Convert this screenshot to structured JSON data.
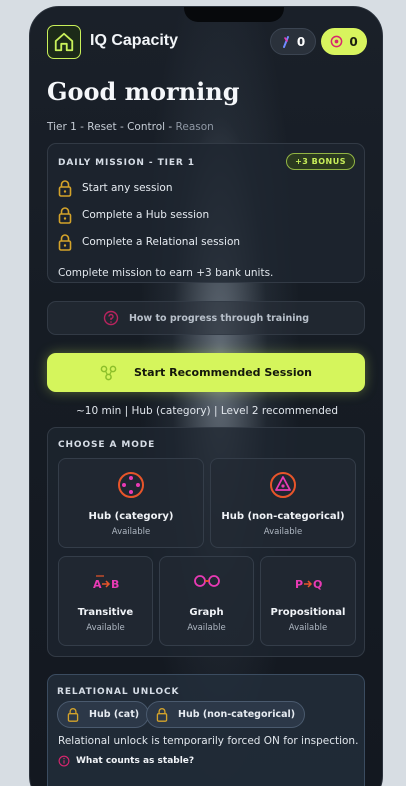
{
  "app": {
    "title": "IQ Capacity"
  },
  "header": {
    "tokens_count": "0",
    "bank_count": "0"
  },
  "greeting": "Good morning",
  "tier_path": {
    "tier": "Tier 1",
    "sep1": " - ",
    "reset": "Reset",
    "sep2": " - ",
    "control": "Control",
    "sep3": " - ",
    "reason": "Reason"
  },
  "mission": {
    "title": "DAILY MISSION - TIER 1",
    "bonus": "+3 BONUS",
    "items": [
      {
        "label": "Start any session"
      },
      {
        "label": "Complete a Hub session"
      },
      {
        "label": "Complete a Relational session"
      }
    ],
    "footer": "Complete mission to earn +3 bank units."
  },
  "howto": {
    "label": "How to progress through training"
  },
  "start": {
    "label": "Start Recommended Session"
  },
  "recommendation": "~10 min | Hub (category) | Level 2 recommended",
  "modes": {
    "title": "CHOOSE A MODE",
    "items": [
      {
        "name": "Hub (category)",
        "status": "Available"
      },
      {
        "name": "Hub (non-categorical)",
        "status": "Available"
      },
      {
        "name": "Transitive",
        "status": "Available"
      },
      {
        "name": "Graph",
        "status": "Available"
      },
      {
        "name": "Propositional",
        "status": "Available"
      }
    ]
  },
  "unlock": {
    "title": "RELATIONAL UNLOCK",
    "chips": [
      {
        "label": "Hub (cat)"
      },
      {
        "label": "Hub (non-categorical)"
      }
    ],
    "note": "Relational unlock is temporarily forced ON for inspection.",
    "stable_link": "What counts as stable?"
  },
  "colors": {
    "accent": "#d5f55c",
    "lock": "#d4a32a",
    "icon_magenta": "#e83ab4",
    "icon_orange": "#e8552a"
  },
  "icons": [
    "home-icon",
    "token-icon",
    "bank-icon",
    "lock-icon",
    "progress-icon",
    "session-icon",
    "hub-category-icon",
    "hub-noncategorical-icon",
    "transitive-icon",
    "graph-icon",
    "propositional-icon",
    "info-icon"
  ]
}
